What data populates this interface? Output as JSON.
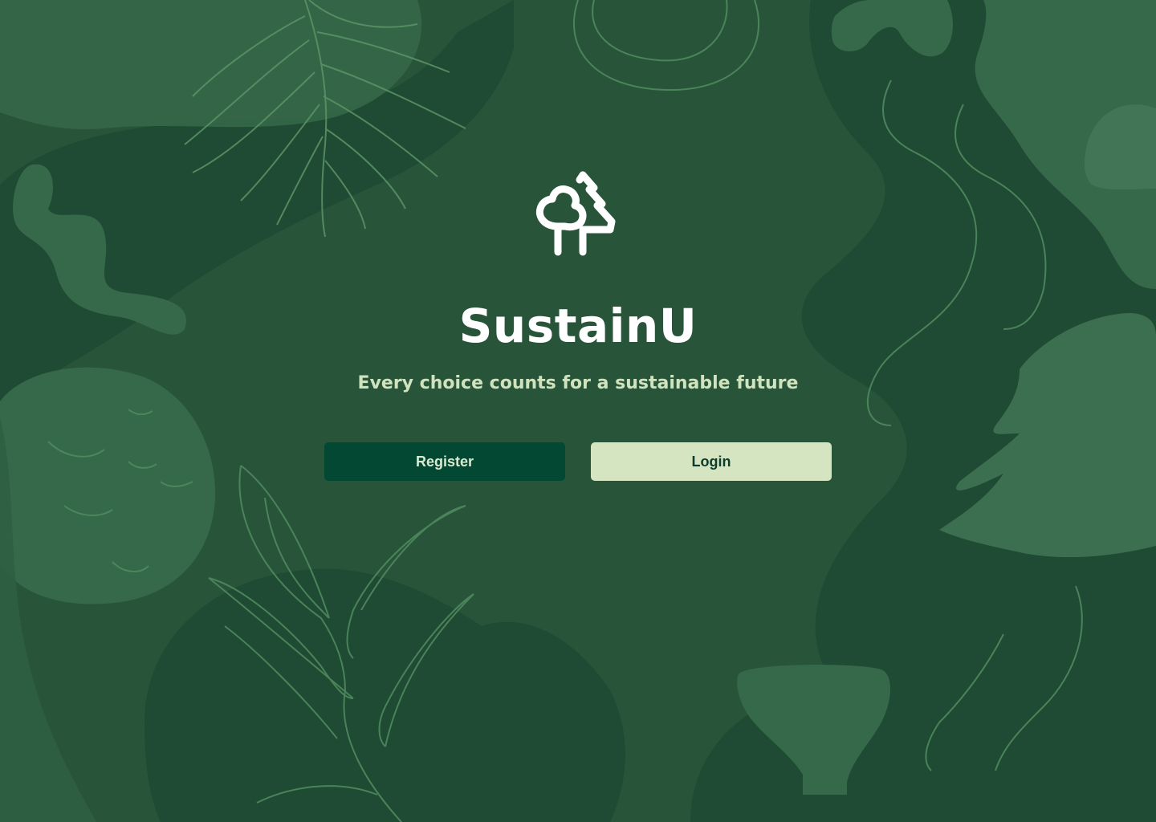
{
  "app": {
    "title": "SustainU",
    "tagline": "Every choice counts for a sustainable future",
    "logo_icon": "trees-icon"
  },
  "actions": {
    "register_label": "Register",
    "login_label": "Login"
  },
  "colors": {
    "background": "#285539",
    "title": "#ffffff",
    "tagline": "#cfe3bf",
    "register_bg": "#034833",
    "login_bg": "#d5e5c1"
  }
}
